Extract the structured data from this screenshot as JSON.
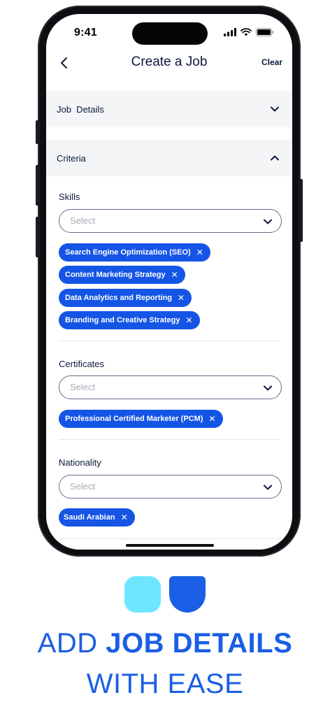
{
  "status_bar": {
    "time": "9:41"
  },
  "nav": {
    "title": "Create a Job",
    "clear_label": "Clear"
  },
  "sections": {
    "job_details": {
      "label": "Job  Details"
    },
    "criteria": {
      "label": "Criteria"
    }
  },
  "skills": {
    "label": "Skills",
    "placeholder": "Select",
    "chips": [
      "Search Engine Optimization (SEO)",
      "Content Marketing Strategy",
      "Data Analytics and Reporting",
      "Branding and Creative Strategy"
    ]
  },
  "certificates": {
    "label": "Certificates",
    "placeholder": "Select",
    "chips": [
      "Professional Certified Marketer (PCM)"
    ]
  },
  "nationality": {
    "label": "Nationality",
    "placeholder": "Select",
    "chips": [
      "Saudi Arabian"
    ]
  },
  "tagline": {
    "line1_light": "ADD ",
    "line1_bold": "JOB DETAILS",
    "line2": "WITH EASE"
  },
  "colors": {
    "accent": "#1555e6",
    "promo_cyan": "#6ee6ff",
    "promo_blue": "#1a5ee5",
    "text_dark": "#0b1a3a"
  },
  "chip_remove_glyph": "✕"
}
